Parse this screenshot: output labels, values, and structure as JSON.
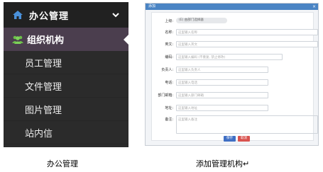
{
  "sidebar": {
    "header_title": "办公管理",
    "active_item": "组织机构",
    "items": [
      "员工管理",
      "文件管理",
      "图片管理",
      "站内信"
    ],
    "icons": {
      "header": "home-icon",
      "active": "group-icon",
      "toggle": "chevron-down-icon"
    },
    "colors": {
      "background": "#2b2b2b",
      "header": "#212121",
      "active": "#4b3e4e"
    }
  },
  "captions": {
    "left": "办公管理",
    "right": "添加管理机构↵"
  },
  "dialog": {
    "title": "添加",
    "close_glyph": "×",
    "superior": {
      "label": "上级:",
      "value": "(E) 由部门选择器"
    },
    "fields": [
      {
        "label": "名称:",
        "placeholder": "这里输入名称"
      },
      {
        "label": "英文:",
        "placeholder": "这里输入英文"
      },
      {
        "label": "编码:",
        "placeholder": "这里输入编码 (不重复, 禁止修改)"
      },
      {
        "label": "负责人:",
        "placeholder": "这里输入负责人"
      },
      {
        "label": "电话:",
        "placeholder": "这里输入电话"
      },
      {
        "label": "部门邮箱:",
        "placeholder": "这里输入部门邮箱"
      },
      {
        "label": "地址:",
        "placeholder": "这里输入地址"
      }
    ],
    "remark": {
      "label": "备注:",
      "placeholder": "这里输入备注"
    },
    "buttons": {
      "save": "保存",
      "cancel": "取消"
    },
    "colors": {
      "title_bar": "#4a84c4",
      "save": "#3f6fc4",
      "cancel": "#d9534f"
    }
  }
}
